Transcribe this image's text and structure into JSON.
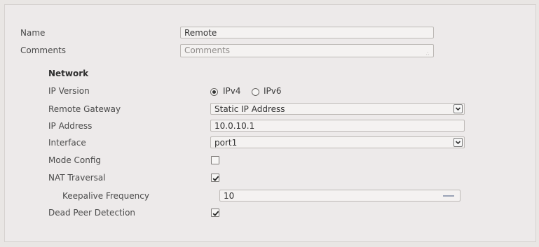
{
  "form": {
    "name_label": "Name",
    "name_value": "Remote",
    "comments_label": "Comments",
    "comments_placeholder": "Comments"
  },
  "network": {
    "heading": "Network",
    "ip_version": {
      "label": "IP Version",
      "options": [
        "IPv4",
        "IPv6"
      ],
      "selected": "IPv4"
    },
    "remote_gateway": {
      "label": "Remote Gateway",
      "value": "Static IP Address"
    },
    "ip_address": {
      "label": "IP Address",
      "value": "10.0.10.1"
    },
    "interface": {
      "label": "Interface",
      "value": "port1"
    },
    "mode_config": {
      "label": "Mode Config",
      "checked": false
    },
    "nat_traversal": {
      "label": "NAT Traversal",
      "checked": true
    },
    "keepalive_frequency": {
      "label": "Keepalive Frequency",
      "value": "10"
    },
    "dead_peer_detection": {
      "label": "Dead Peer Detection",
      "checked": true
    }
  }
}
